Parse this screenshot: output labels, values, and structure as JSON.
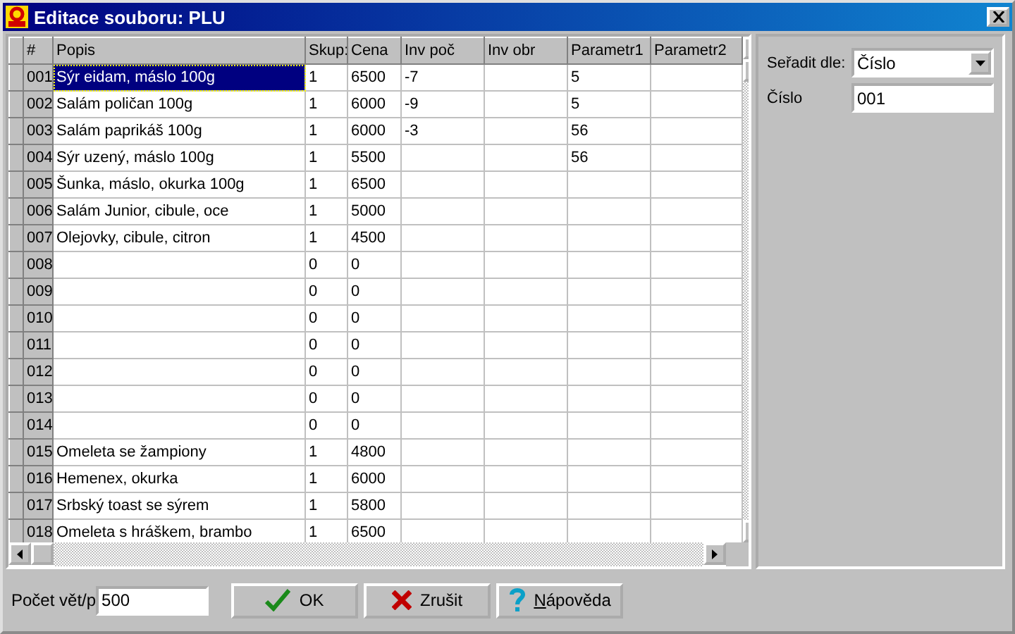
{
  "window": {
    "title": "Editace souboru: PLU"
  },
  "table": {
    "columns": [
      "#",
      "Popis",
      "Skup:",
      "Cena",
      "Inv poč",
      "Inv obr",
      "Parametr1",
      "Parametr2"
    ],
    "rows": [
      {
        "number": "001",
        "popis": "Sýr eidam, máslo 100g",
        "skup": "1",
        "cena": "6500",
        "inv_poc": "-7",
        "parametr1": "5",
        "selected": true
      },
      {
        "number": "002",
        "popis": "Salám poličan 100g",
        "skup": "1",
        "cena": "6000",
        "inv_poc": "-9",
        "parametr1": "5",
        "selected": false
      },
      {
        "number": "003",
        "popis": "Salám paprikáš 100g",
        "skup": "1",
        "cena": "6000",
        "inv_poc": "-3",
        "parametr1": "56",
        "selected": false
      },
      {
        "number": "004",
        "popis": "Sýr uzený, máslo 100g",
        "skup": "1",
        "cena": "5500",
        "parametr1": "56",
        "selected": false
      },
      {
        "number": "005",
        "popis": "Šunka, máslo, okurka 100g",
        "skup": "1",
        "cena": "6500",
        "selected": false
      },
      {
        "number": "006",
        "popis": "Salám Junior, cibule, oce",
        "skup": "1",
        "cena": "5000",
        "selected": false
      },
      {
        "number": "007",
        "popis": "Olejovky, cibule, citron",
        "skup": "1",
        "cena": "4500",
        "selected": false
      },
      {
        "number": "008",
        "skup": "0",
        "cena": "0",
        "selected": false
      },
      {
        "number": "009",
        "skup": "0",
        "cena": "0",
        "selected": false
      },
      {
        "number": "010",
        "skup": "0",
        "cena": "0",
        "selected": false
      },
      {
        "number": "011",
        "skup": "0",
        "cena": "0",
        "selected": false
      },
      {
        "number": "012",
        "skup": "0",
        "cena": "0",
        "selected": false
      },
      {
        "number": "013",
        "skup": "0",
        "cena": "0",
        "selected": false
      },
      {
        "number": "014",
        "skup": "0",
        "cena": "0",
        "selected": false
      },
      {
        "number": "015",
        "popis": "Omeleta se žampiony",
        "skup": "1",
        "cena": "4800",
        "selected": false
      },
      {
        "number": "016",
        "popis": "Hemenex, okurka",
        "skup": "1",
        "cena": "6000",
        "selected": false
      },
      {
        "number": "017",
        "popis": "Srbský toast se sýrem",
        "skup": "1",
        "cena": "5800",
        "selected": false
      },
      {
        "number": "018",
        "popis": "Omeleta s hráškem, brambo",
        "skup": "1",
        "cena": "6500",
        "selected": false
      }
    ]
  },
  "side_panel": {
    "sort_label": "Seřadit dle:",
    "sort_value": "Číslo",
    "number_label": "Číslo",
    "number_value": "001"
  },
  "bottom_bar": {
    "count_label": "Počet vět/p",
    "count_value": "500",
    "buttons": [
      {
        "kind": "ok",
        "label": "OK"
      },
      {
        "kind": "cancel",
        "label": "Zrušit"
      },
      {
        "kind": "help",
        "label": "Nápověda",
        "first_letter_underlined": true
      }
    ]
  }
}
